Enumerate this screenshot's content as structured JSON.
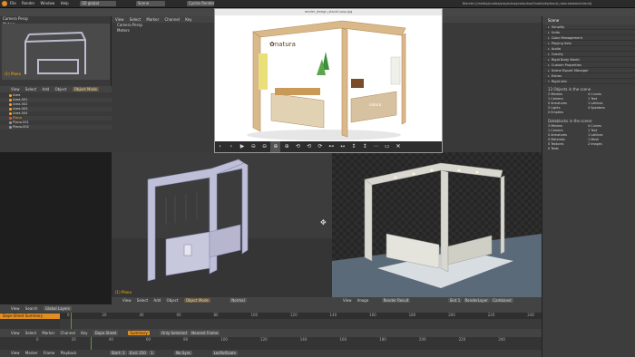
{
  "topbar": {
    "menus": [
      "File",
      "Render",
      "Window",
      "Help"
    ],
    "screen_layout": "3D global",
    "scene": "Scene",
    "engine": "Cycles Render",
    "app_title": "Blender [/media/prueba/proyectos/productos/Ovaduidis/stand_naturalestand.blend]"
  },
  "left": {
    "camera_label": "Camera Persp",
    "meters_label": "Meters",
    "outliner_header": [
      "View",
      "Select",
      "Add",
      "Object"
    ],
    "outliner_mode": "Object Mode",
    "outliner_rows": [
      "Area",
      "Area.001",
      "Area.002",
      "Area.003",
      "Area.004",
      "Plano",
      "Plano.001",
      "Plano.002"
    ],
    "cam_label": "(1) Plano"
  },
  "middle_top": {
    "menus": [
      "View",
      "Select",
      "Marker",
      "Channel",
      "Key"
    ],
    "field": "F-Curve",
    "camera_label": "Camera Persp",
    "meters_label": "Meters"
  },
  "viewer": {
    "title": "render_design_stand-Loop.jpg",
    "toolbar": [
      "‹",
      "›",
      "▶",
      "⊖",
      "⊖",
      "⊕",
      "⊕",
      "⟲",
      "⟲",
      "⟳",
      "⊷",
      "↔",
      "↕",
      "↕",
      "⋯",
      "▭",
      "✕"
    ]
  },
  "props": {
    "tab": "Scene",
    "rows": [
      "Simplify",
      "Units",
      "Color Management",
      "Playing Sets",
      "Audio",
      "Gravity",
      "Rigid Body World",
      "Custom Properties",
      "Scene Export Manager",
      "Extras",
      "Rigid info"
    ],
    "stats_header": "13 Objects in the scene",
    "stats": [
      "2 Meshes",
      "1 Camera",
      "0 Armatures",
      "5 Lights",
      "0 Empties",
      "4 Curves",
      "1 Text",
      "1 Lattices",
      "4 Speakers"
    ],
    "database_header": "Datablocks in the scene:",
    "db": [
      "3 Meshes",
      "1 Camera",
      "0 Armatures",
      "0 Materials",
      "0 Textures",
      "0 Tests",
      "4 Curves",
      "1 Text",
      "1 Lattices",
      "1 Mesh",
      "2 Images"
    ]
  },
  "vp_left": {
    "label": "(1) Plano",
    "header": [
      "View",
      "Select",
      "Add",
      "Object"
    ],
    "mode": "Object Mode",
    "orientation": "Normal"
  },
  "vp_right": {
    "header": [
      "View",
      "Image"
    ],
    "image": "Render Result",
    "slot": "Slot 1",
    "layer": "RenderLayer",
    "pass": "Combined"
  },
  "timeline": {
    "header_a": [
      "View",
      "Search",
      "Global Layers"
    ],
    "dope_label": "Dope Sheet Summary",
    "ruler": [
      "0",
      "20",
      "40",
      "60",
      "80",
      "100",
      "120",
      "140",
      "160",
      "180",
      "200",
      "220",
      "240"
    ],
    "header_b": [
      "View",
      "Select",
      "Marker",
      "Channel",
      "Key"
    ],
    "mode_b": "Dope Sheet",
    "summary": "Summary",
    "only_selected": "Only Selected",
    "nearest": "Nearest Frame",
    "header_d": [
      "View",
      "Marker",
      "Frame",
      "Playback"
    ],
    "start": "Start: 1",
    "end": "End: 250",
    "current": "1",
    "sync": "No Sync",
    "keying": "LocRotScale"
  },
  "colors": {
    "accent": "#e28d1e",
    "panel": "#3d3d3d",
    "header": "#434343"
  }
}
